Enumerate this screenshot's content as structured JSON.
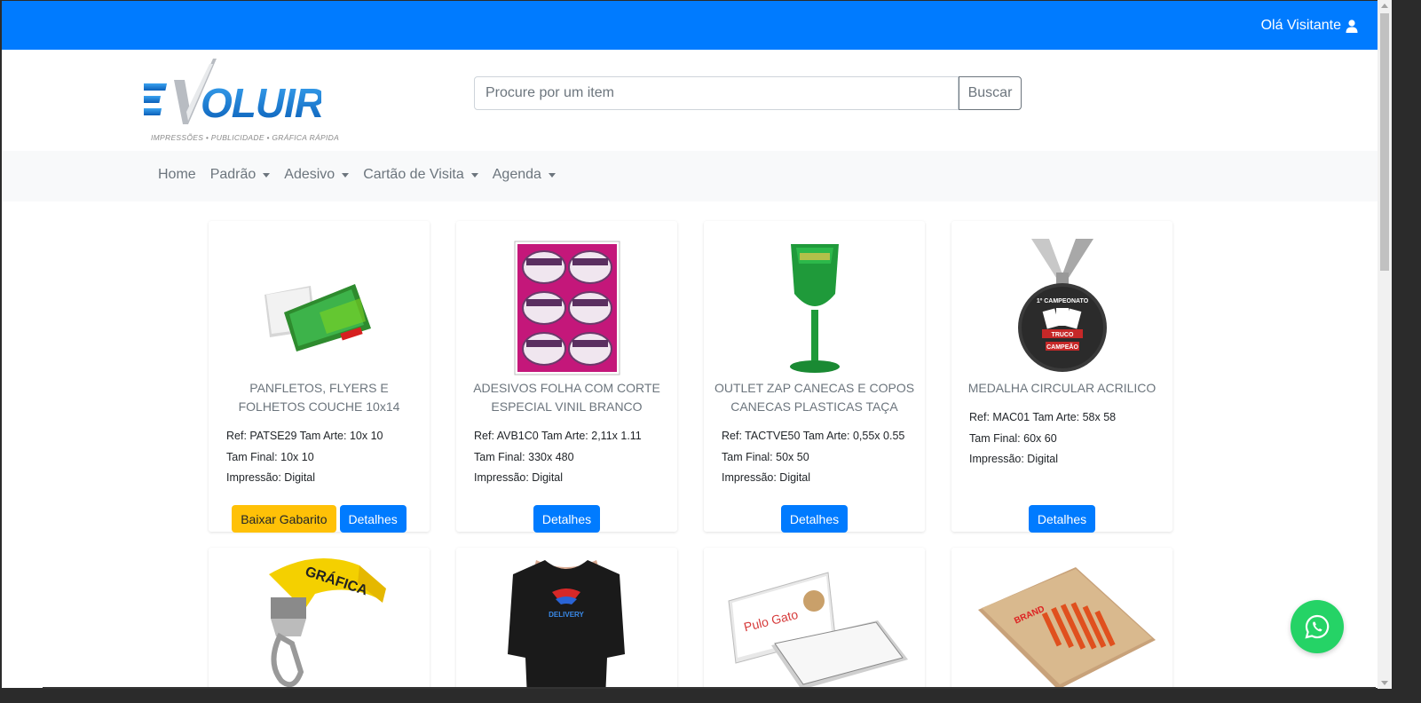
{
  "topbar": {
    "greeting": "Olá Visitante",
    "bg": "#007bff"
  },
  "logo": {
    "text": "VOLUIR",
    "e": "E",
    "tagline": "IMPRESSÕES • PUBLICIDADE • GRÁFICA RÁPIDA"
  },
  "search": {
    "placeholder": "Procure por um item",
    "button": "Buscar"
  },
  "nav": {
    "items": [
      {
        "label": "Home",
        "dropdown": false
      },
      {
        "label": "Padrão",
        "dropdown": true
      },
      {
        "label": "Adesivo",
        "dropdown": true
      },
      {
        "label": "Cartão de Visita",
        "dropdown": true
      },
      {
        "label": "Agenda",
        "dropdown": true
      }
    ]
  },
  "products": [
    {
      "title": "PANFLETOS, FLYERS E FOLHETOS COUCHE 10x14",
      "ref": "Ref: PATSE29 Tam Arte: 10x 10",
      "final": "Tam Final: 10x 10",
      "print": "Impressão: Digital",
      "download": "Baixar Gabarito",
      "details": "Detalhes"
    },
    {
      "title": "ADESIVOS FOLHA COM CORTE ESPECIAL VINIL BRANCO",
      "ref": "Ref: AVB1C0 Tam Arte: 2,11x 1.11",
      "final": "Tam Final: 330x 480",
      "print": "Impressão: Digital",
      "details": "Detalhes"
    },
    {
      "title": "OUTLET ZAP CANECAS E COPOS CANECAS PLASTICAS TAÇA",
      "ref": "Ref: TACTVE50 Tam Arte: 0,55x 0.55",
      "final": "Tam Final: 50x 50",
      "print": "Impressão: Digital",
      "details": "Detalhes"
    },
    {
      "title": "MEDALHA CIRCULAR ACRILICO",
      "ref": "Ref: MAC01 Tam Arte: 58x 58",
      "final": "Tam Final: 60x 60",
      "print": "Impressão: Digital",
      "details": "Detalhes"
    }
  ],
  "images": {
    "medal_top": "1º CAMPEONATO",
    "medal_mid": "TRUCO",
    "medal_bottom": "CAMPEÃO",
    "lanyard": "GRÁFICA",
    "shirt": "DELIVERY",
    "card_brand": "Pulo Gato",
    "book": "BRAND"
  }
}
